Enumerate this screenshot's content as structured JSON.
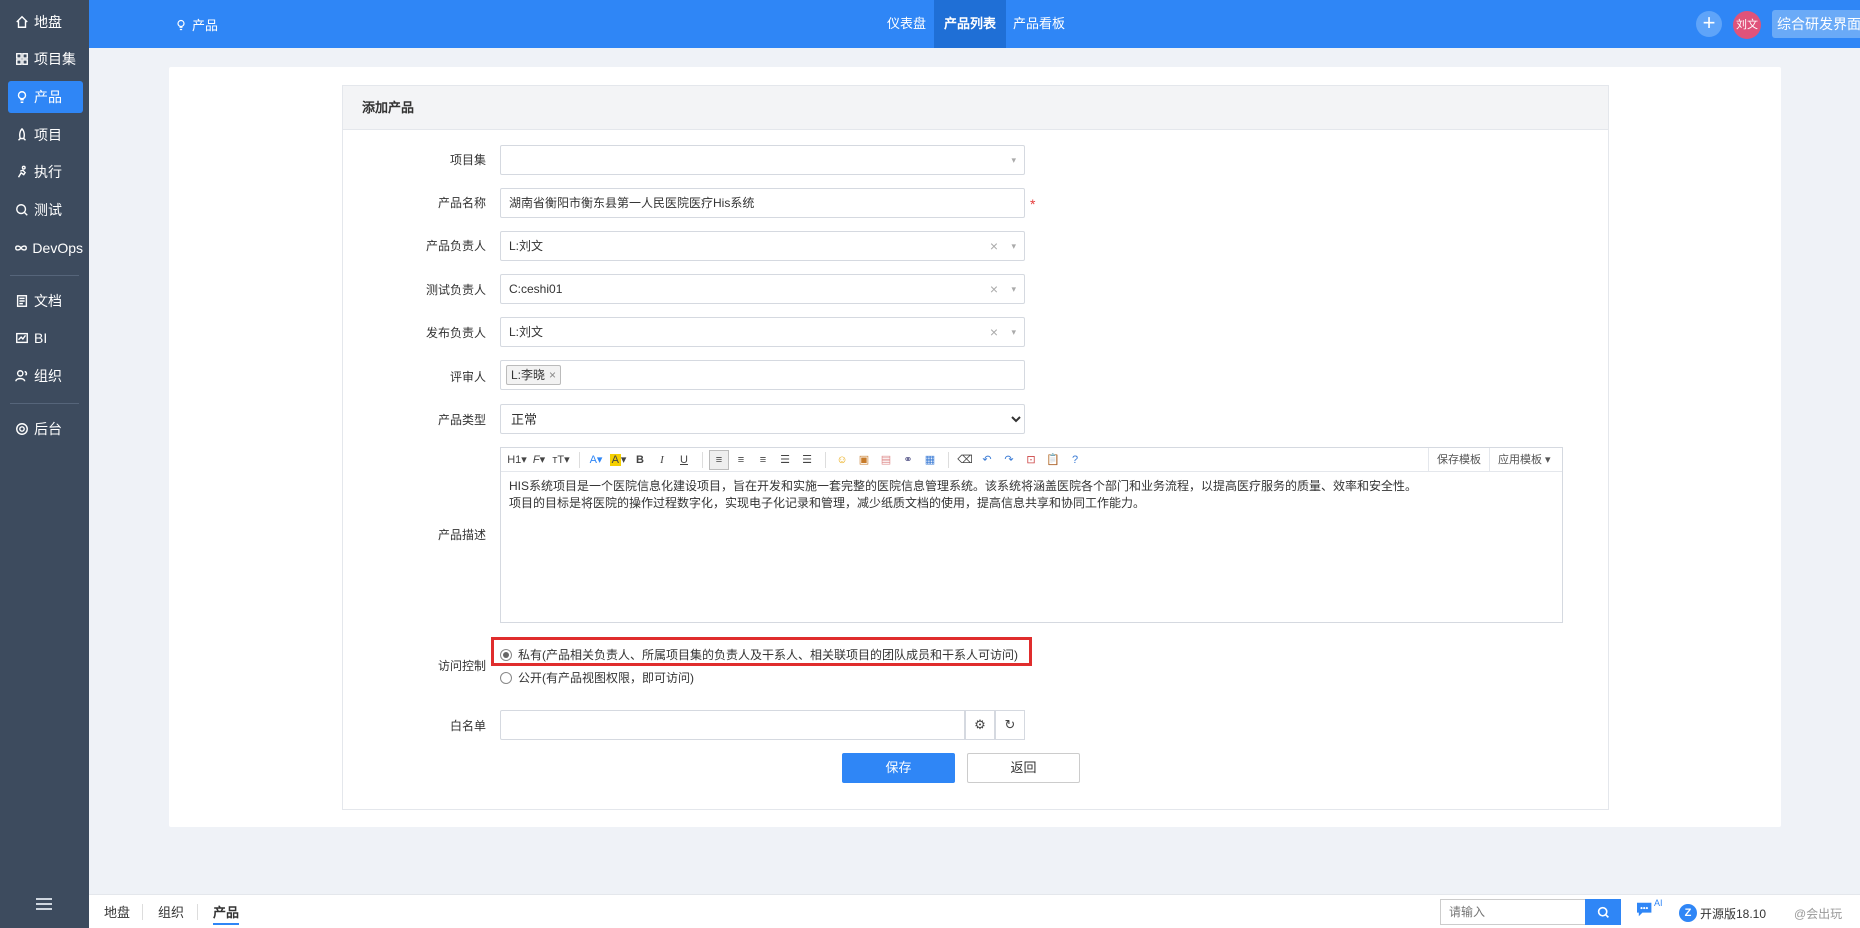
{
  "sidebar": {
    "items": [
      {
        "label": "地盘",
        "icon": "home-icon"
      },
      {
        "label": "项目集",
        "icon": "grid-icon"
      },
      {
        "label": "产品",
        "icon": "bulb-icon"
      },
      {
        "label": "项目",
        "icon": "rocket-icon"
      },
      {
        "label": "执行",
        "icon": "run-icon"
      },
      {
        "label": "测试",
        "icon": "test-icon"
      },
      {
        "label": "DevOps",
        "icon": "infinity-icon"
      },
      {
        "label": "文档",
        "icon": "doc-icon"
      },
      {
        "label": "BI",
        "icon": "chart-icon"
      },
      {
        "label": "组织",
        "icon": "people-icon"
      },
      {
        "label": "后台",
        "icon": "gear-icon"
      }
    ]
  },
  "header": {
    "breadcrumb": "产品",
    "tabs": [
      "仪表盘",
      "产品列表",
      "产品看板"
    ],
    "add_label": "+",
    "avatar": "刘文",
    "rd_button": "综合研发界面"
  },
  "form": {
    "title": "添加产品",
    "program_label": "项目集",
    "program_value": "",
    "name_label": "产品名称",
    "name_value": "湖南省衡阳市衡东县第一人民医院医疗His系统",
    "required_mark": "*",
    "po_label": "产品负责人",
    "po_value": "L:刘文",
    "qd_label": "测试负责人",
    "qd_value": "C:ceshi01",
    "rd_label": "发布负责人",
    "rd_value": "L:刘文",
    "reviewer_label": "评审人",
    "reviewer_tag": "L:李晓",
    "type_label": "产品类型",
    "type_value": "正常",
    "desc_label": "产品描述",
    "desc_line1": "HIS系统项目是一个医院信息化建设项目，旨在开发和实施一套完整的医院信息管理系统。该系统将涵盖医院各个部门和业务流程，以提高医疗服务的质量、效率和安全性。",
    "desc_line2": "项目的目标是将医院的操作过程数字化，实现电子化记录和管理，减少纸质文档的使用，提高信息共享和协同工作能力。",
    "acl_label": "访问控制",
    "acl_private": "私有(产品相关负责人、所属项目集的负责人及干系人、相关联项目的团队成员和干系人可访问)",
    "acl_open": "公开(有产品视图权限，即可访问)",
    "whitelist_label": "白名单",
    "save": "保存",
    "back": "返回"
  },
  "editor": {
    "heading": "H1",
    "save_template": "保存模板",
    "apply_template": "应用模板"
  },
  "bottom": {
    "tabs": [
      "地盘",
      "组织",
      "产品"
    ],
    "search_placeholder": "请输入",
    "ai_label": "AI",
    "version": "开源版18.10",
    "watermark": "@会出玩"
  },
  "colors": {
    "primary": "#2f86f6",
    "sidebar": "#3d4b5e",
    "highlight": "#e02d2d"
  }
}
